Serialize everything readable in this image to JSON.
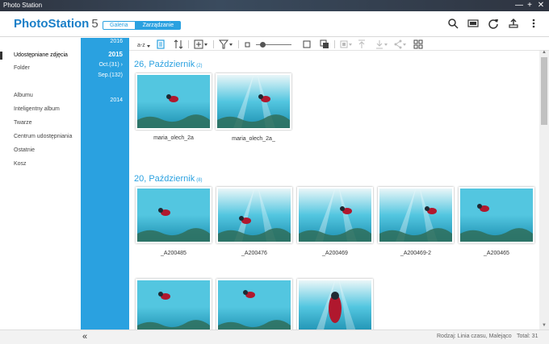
{
  "window": {
    "title": "Photo Station",
    "buttons": {
      "minimize": "—",
      "maximize": "+",
      "close": "✕"
    }
  },
  "header": {
    "logo_bold": "PhotoStation",
    "logo_num": "5",
    "mode_gallery": "Galeria",
    "mode_manage": "Zarządzanie",
    "icons": [
      "search-icon",
      "slideshow-icon",
      "refresh-icon",
      "upload-icon",
      "more-icon"
    ]
  },
  "sidebar": {
    "items": [
      {
        "label": "Udostępniane zdjęcia",
        "active": true
      },
      {
        "label": "Folder"
      },
      {
        "label": "Albumu"
      },
      {
        "label": "Inteligentny album"
      },
      {
        "label": "Twarze"
      },
      {
        "label": "Centrum udostępniania"
      },
      {
        "label": "Ostatnie"
      },
      {
        "label": "Kosz"
      }
    ]
  },
  "timeline": {
    "years": [
      {
        "label": "2016"
      },
      {
        "label": "2015",
        "current": true
      },
      {
        "label": "Oct.(31) ›"
      },
      {
        "label": "Sep.(132)"
      },
      {
        "label": "2014"
      }
    ]
  },
  "toolbar": {
    "icons": [
      "sort-az-icon",
      "timeline-view-icon",
      "sort-order-icon",
      "add-icon",
      "filter-icon",
      "thumb-small-icon",
      "zoom-slider",
      "thumb-large-icon",
      "thumb-fit-icon",
      "copy-icon",
      "upload-icon",
      "download-icon",
      "share-icon",
      "grid-icon"
    ],
    "zoom_level": 0.18
  },
  "groups": [
    {
      "title": "26, Październik",
      "count": "(2)",
      "photos": [
        {
          "caption": "maria_olech_2a"
        },
        {
          "caption": "maria_olech_2a_"
        }
      ]
    },
    {
      "title": "20, Październik",
      "count": "(8)",
      "photos": [
        {
          "caption": "_A200485"
        },
        {
          "caption": "_A200476"
        },
        {
          "caption": "_A200469"
        },
        {
          "caption": "_A200469-2"
        },
        {
          "caption": "_A200465"
        },
        {
          "caption": ""
        },
        {
          "caption": ""
        },
        {
          "caption": ""
        }
      ]
    }
  ],
  "status": {
    "collapse": "«",
    "sort": "Rodzaj: Linia czasu, Malejąco",
    "total": "Total: 31"
  },
  "colors": {
    "accent": "#2aa1e0",
    "water": "#1c8fb0",
    "water_light": "#53c6e0"
  }
}
